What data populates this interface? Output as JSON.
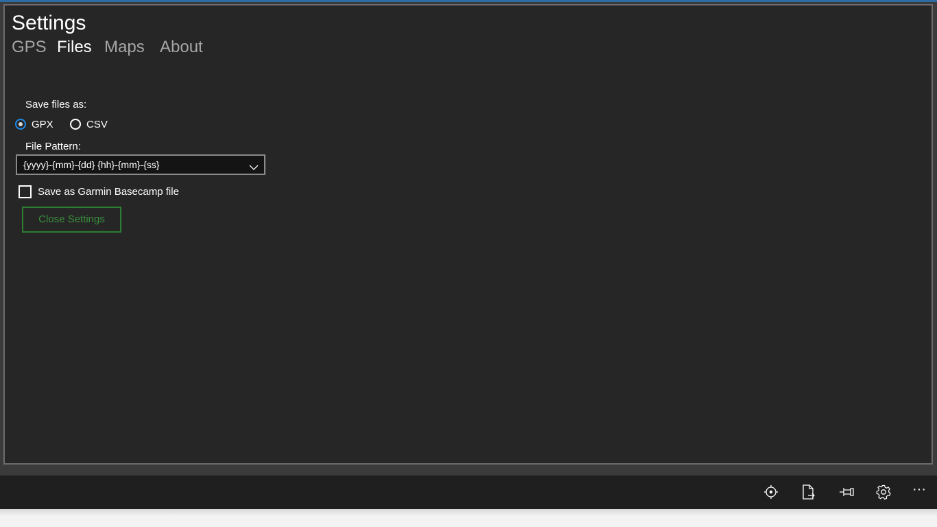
{
  "page": {
    "title": "Settings",
    "tabs": [
      {
        "label": "GPS",
        "active": false
      },
      {
        "label": "Files",
        "active": true
      },
      {
        "label": "Maps",
        "active": false
      },
      {
        "label": "About",
        "active": false
      }
    ]
  },
  "files": {
    "save_as_label": "Save files as:",
    "formats": [
      {
        "label": "GPX",
        "checked": true
      },
      {
        "label": "CSV",
        "checked": false
      }
    ],
    "pattern_label": "File Pattern:",
    "pattern_value": "{yyyy}-{mm}-{dd} {hh}-{mm}-{ss}",
    "garmin_label": "Save as Garmin Basecamp file",
    "garmin_checked": false,
    "close_button": "Close Settings"
  },
  "commandbar": {
    "icons": [
      "locate-icon",
      "export-file-icon",
      "pin-icon",
      "settings-icon"
    ],
    "more": "···"
  },
  "colors": {
    "accent": "#1e88e5",
    "button_green": "#388e3c",
    "panel_bg": "#262626",
    "commandbar_bg": "#1f1f1f"
  }
}
